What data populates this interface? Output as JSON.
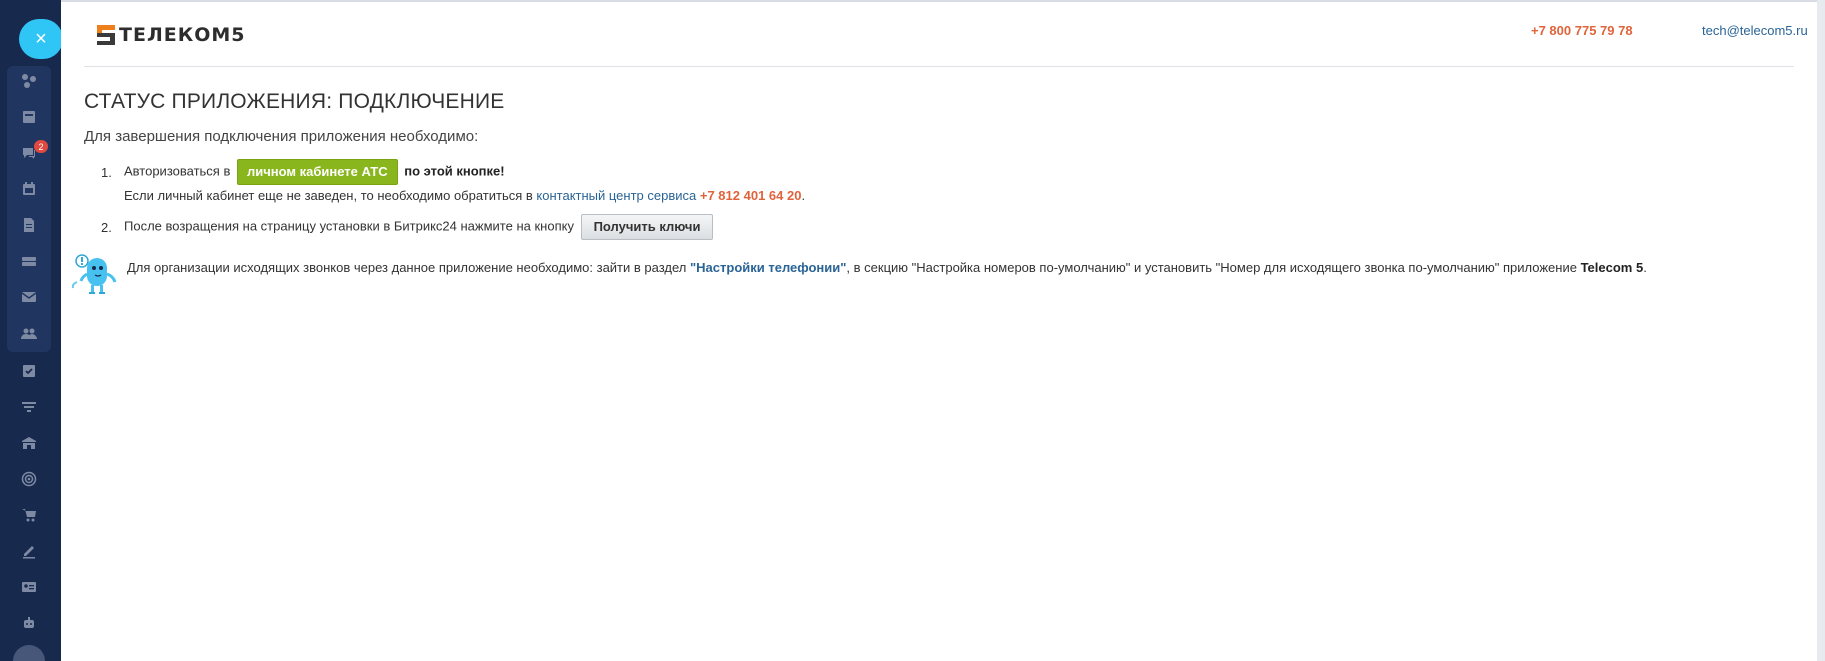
{
  "rail": {
    "close_symbol": "×",
    "badge_count": "2",
    "items": [
      {
        "icon": "crm-flow-icon"
      },
      {
        "icon": "feed-icon"
      },
      {
        "icon": "chat-icon"
      },
      {
        "icon": "calendar-icon"
      },
      {
        "icon": "document-icon"
      },
      {
        "icon": "drive-icon"
      },
      {
        "icon": "mail-icon"
      },
      {
        "icon": "contacts-icon"
      },
      {
        "icon": "tasks-icon"
      },
      {
        "icon": "filter-icon"
      },
      {
        "icon": "store-icon"
      },
      {
        "icon": "target-icon"
      },
      {
        "icon": "cart-icon"
      },
      {
        "icon": "sign-icon"
      },
      {
        "icon": "contact-card-icon"
      },
      {
        "icon": "robot-icon"
      }
    ]
  },
  "header": {
    "logo_text": "ТЕЛЕКОМ5",
    "phone": "+7 800 775 79 78",
    "email": "tech@telecom5.ru"
  },
  "main": {
    "title": "СТАТУС ПРИЛОЖЕНИЯ: ПОДКЛЮЧЕНИЕ",
    "intro": "Для завершения подключения приложения необходимо:",
    "step1": {
      "num": "1.",
      "prefix": "Авторизоваться в",
      "button_label": "личном кабинете АТС",
      "suffix": "по этой кнопке!",
      "line2_prefix": "Если личный кабинет еще не заведен, то необходимо обратиться в",
      "line2_link": "контактный центр сервиса",
      "line2_phone": "+7 812 401 64 20",
      "line2_end": "."
    },
    "step2": {
      "num": "2.",
      "text": "После возращения на страницу установки в Битрикс24 нажмите на кнопку",
      "button_label": "Получить ключи"
    },
    "note": {
      "part1": "Для организации исходящих звонков через данное приложение необходимо: зайти в раздел",
      "link": "\"Настройки телефонии\"",
      "part2": ", в секцию \"Настройка номеров по-умолчанию\" и установить \"Номер для исходящего звонка по-умолчанию\" приложение",
      "app_name": "Telecom 5",
      "end": "."
    }
  },
  "colors": {
    "rail": "#17294d",
    "accent": "#2fc6f6",
    "green_button": "#8ab61d",
    "link": "#2a6496",
    "orange": "#e0643b"
  }
}
